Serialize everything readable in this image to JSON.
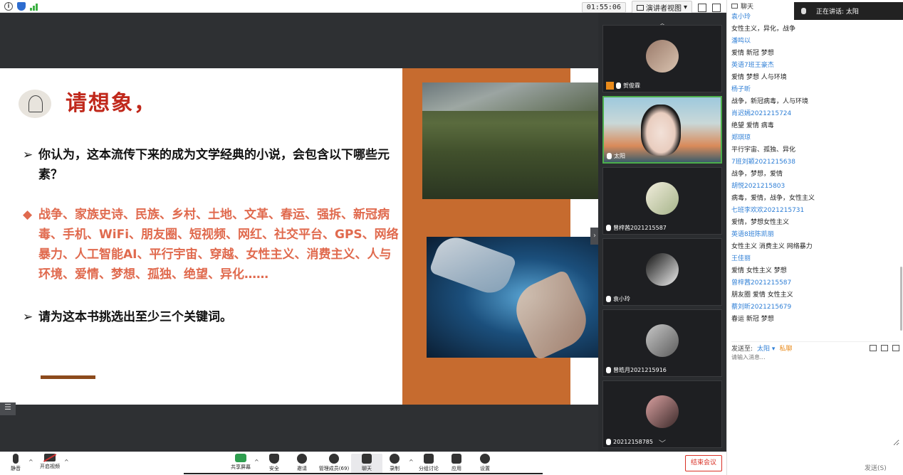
{
  "topbar": {
    "info_label": "i",
    "timer": "01:55:06",
    "view_mode": "演讲者视图"
  },
  "slide": {
    "title": "请想象，",
    "bullet1": "你认为，这本流传下来的成为文学经典的小说，会包含以下哪些元素？",
    "bullet2": "战争、家族史诗、民族、乡村、土地、文革、春运、强拆、新冠病毒、手机、WiFi、朋友圈、短视频、网红、社交平台、GPS、网络暴力、人工智能AI、平行宇宙、穿越、女性主义、消费主义、人与环境、爱情、梦想、孤独、绝望、异化……",
    "bullet3": "请为这本书挑选出至少三个关键词。",
    "bullet_mark_arrow": "➢",
    "bullet_mark_diamond": "◆",
    "colors": {
      "title": "#c0281b",
      "keywords": "#e06a4e",
      "panel": "#c66b2f"
    }
  },
  "videos": [
    {
      "name": "贺俊霖",
      "host": true
    },
    {
      "name": "太阳",
      "active": true
    },
    {
      "name": "曾梓茜2021215587"
    },
    {
      "name": "袁小玲"
    },
    {
      "name": "曾皓月2021215916"
    },
    {
      "name": "20212158785"
    }
  ],
  "chat": {
    "title": "聊天",
    "speaking_label": "正在讲话: 太阳",
    "messages": [
      {
        "name": "袁小玲",
        "text": "女性主义，异化，战争"
      },
      {
        "name": "潘鸣以",
        "text": "爱情 新冠  梦想"
      },
      {
        "name": "英语7班王豪杰",
        "text": "爱情 梦想 人与环境"
      },
      {
        "name": "杨子昕",
        "text": "战争，新冠病毒，人与环境"
      },
      {
        "name": "肖迟嫣2021215724",
        "text": "绝望 爱情 病毒"
      },
      {
        "name": "郑琪琼",
        "text": "平行宇宙、孤独、异化"
      },
      {
        "name": "7班刘颖2021215638",
        "text": "战争，梦想，爱情"
      },
      {
        "name": "胡悦2021215803",
        "text": "病毒，爱情，战争，女性主义"
      },
      {
        "name": "七班李欢欢2021215731",
        "text": "爱情，梦想女性主义"
      },
      {
        "name": "英语8班陈凯丽",
        "text": "女性主义 消费主义 网络暴力"
      },
      {
        "name": "王佳丽",
        "text": "爱情 女性主义 梦想"
      },
      {
        "name": "曾梓茜2021215587",
        "text": "朋友圈 爱情 女性主义"
      },
      {
        "name": "蔡刘昕2021215679",
        "text": "春运 新冠  梦想"
      }
    ],
    "send_to_label": "发送至:",
    "send_to_value": "太阳 ▾",
    "private_label": "私聊",
    "input_placeholder": "请输入消息...",
    "send_button": "发送(S)"
  },
  "toolbar": {
    "mute": "静音",
    "video": "开启视频",
    "share": "共享屏幕",
    "security": "安全",
    "invite": "邀请",
    "members": "管理成员(69)",
    "chat": "聊天",
    "record": "录制",
    "breakout": "分组讨论",
    "apps": "应用",
    "settings": "设置",
    "end": "结束会议"
  }
}
